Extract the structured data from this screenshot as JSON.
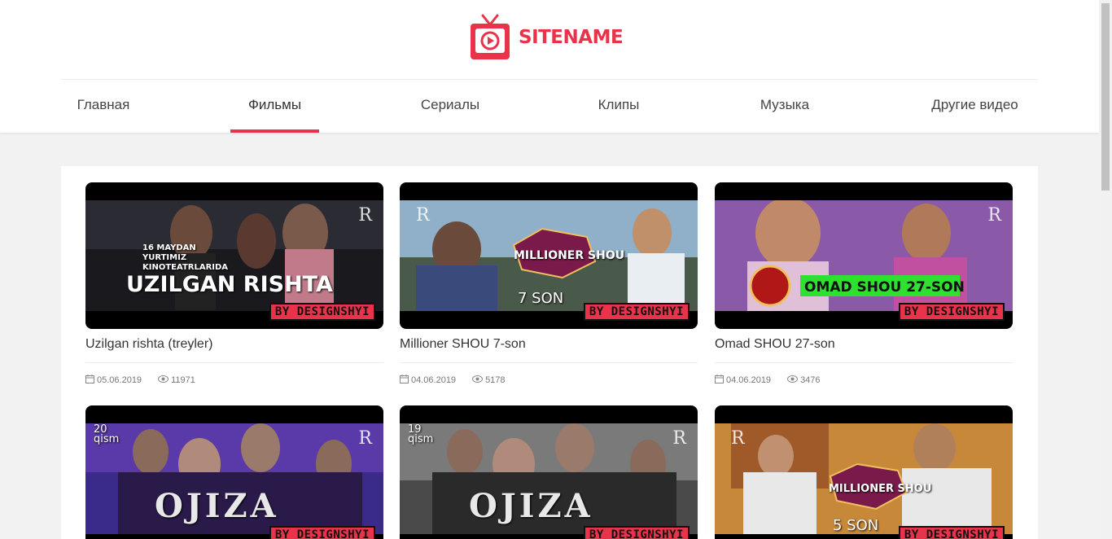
{
  "site": {
    "logo_text": "SITENAME",
    "brand_color": "#e8334a"
  },
  "nav": [
    {
      "label": "Главная",
      "active": false
    },
    {
      "label": "Фильмы",
      "active": true
    },
    {
      "label": "Сериалы",
      "active": false
    },
    {
      "label": "Клипы",
      "active": false
    },
    {
      "label": "Музыка",
      "active": false
    },
    {
      "label": "Другие видео",
      "active": false
    }
  ],
  "videos": [
    {
      "title": "Uzilgan rishta (treyler)",
      "date": "05.06.2019",
      "views": "11971",
      "overlay_text": "UZILGAN RISHTA",
      "overlay_sub": "16 MAYDAN YURTIMIZ KINOTEATRLARIDA",
      "badge": "BY DESIGNSHYI"
    },
    {
      "title": "Millioner SHOU 7-son",
      "date": "04.06.2019",
      "views": "5178",
      "overlay_text": "MILLIONER SHOU",
      "overlay_sub": "7 SON",
      "badge": "BY DESIGNSHYI"
    },
    {
      "title": "Omad SHOU 27-son",
      "date": "04.06.2019",
      "views": "3476",
      "overlay_text": "OMAD SHOU 27-SON",
      "overlay_sub": "",
      "badge": "BY DESIGNSHYI"
    },
    {
      "title": "",
      "date": "",
      "views": "",
      "overlay_text": "OJIZA",
      "overlay_sub": "20 qism",
      "badge": "BY DESIGNSHYI"
    },
    {
      "title": "",
      "date": "",
      "views": "",
      "overlay_text": "OJIZA",
      "overlay_sub": "19 qism",
      "badge": "BY DESIGNSHYI"
    },
    {
      "title": "",
      "date": "",
      "views": "",
      "overlay_text": "MILLIONER SHOU",
      "overlay_sub": "5 SON",
      "badge": "BY DESIGNSHYI"
    }
  ]
}
